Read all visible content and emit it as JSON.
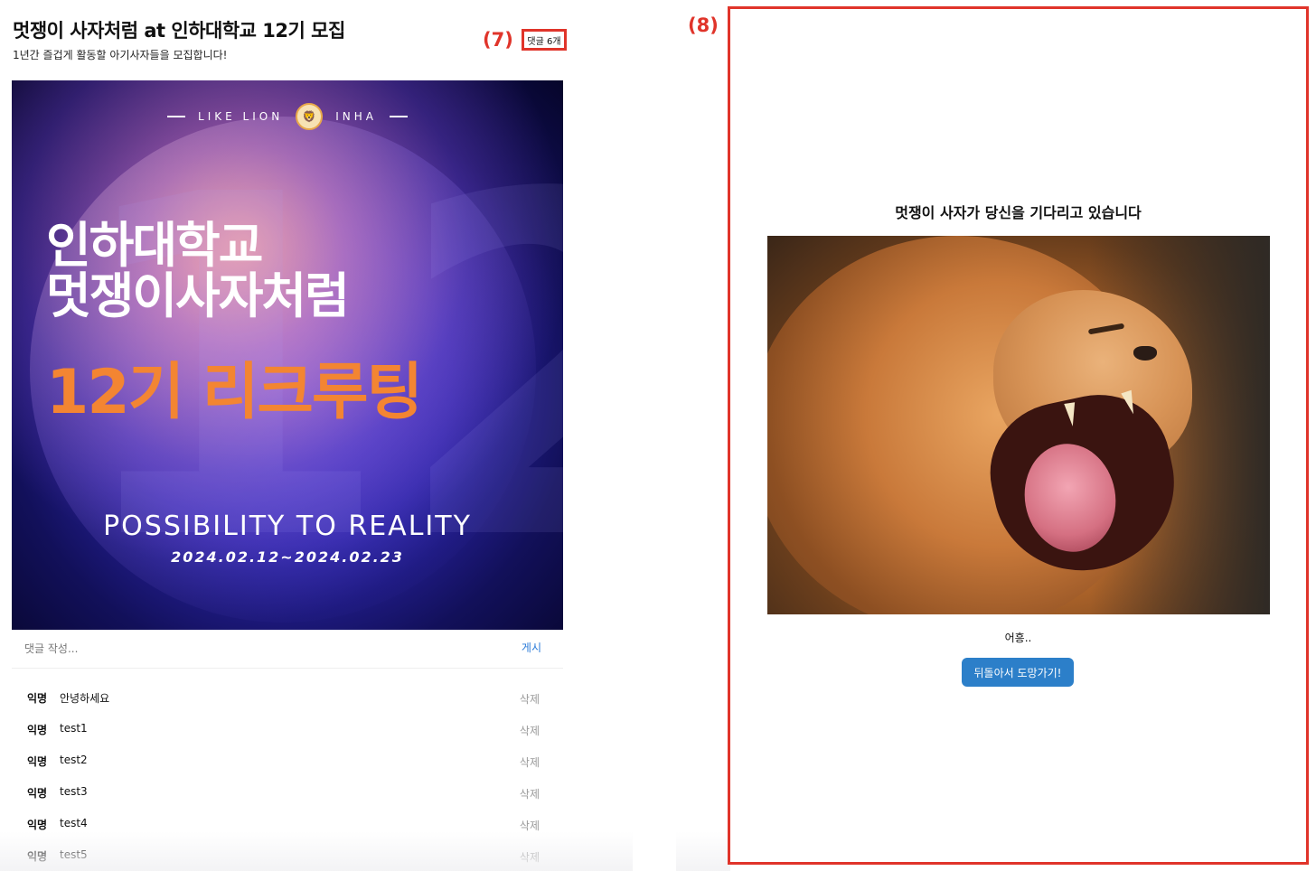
{
  "post": {
    "title": "멋쟁이 사자처럼 at 인하대학교 12기 모집",
    "subtitle": "1년간 즐겁게 활동할 아기사자들을 모집합니다!",
    "comment_count_label": "댓글 6개"
  },
  "annotations": {
    "label_7": "(7)",
    "label_8": "(8)",
    "color": "#e0342a"
  },
  "poster": {
    "brand_left": "LIKE LION",
    "brand_right": "INHA",
    "logo_icon": "lion-logo-icon",
    "headline_1": "인하대학교",
    "headline_2": "멋쟁이사자처럼",
    "headline_3": "12기 리크루팅",
    "tagline": "POSSIBILITY TO REALITY",
    "dates": "2024.02.12~2024.02.23",
    "accent_color": "#f38532"
  },
  "comment_form": {
    "placeholder": "댓글 작성...",
    "submit_label": "게시",
    "submit_color": "#2a7ad8"
  },
  "comments": [
    {
      "author": "익명",
      "text": "안녕하세요",
      "delete_label": "삭제"
    },
    {
      "author": "익명",
      "text": "test1",
      "delete_label": "삭제"
    },
    {
      "author": "익명",
      "text": "test2",
      "delete_label": "삭제"
    },
    {
      "author": "익명",
      "text": "test3",
      "delete_label": "삭제"
    },
    {
      "author": "익명",
      "text": "test4",
      "delete_label": "삭제"
    },
    {
      "author": "익명",
      "text": "test5",
      "delete_label": "삭제"
    }
  ],
  "modal": {
    "title": "멋쟁이 사자가 당신을 기다리고 있습니다",
    "image_subject": "roaring-lion",
    "caption": "어흥..",
    "escape_button_label": "뒤돌아서 도망가기!",
    "button_color": "#2c7fc9"
  }
}
